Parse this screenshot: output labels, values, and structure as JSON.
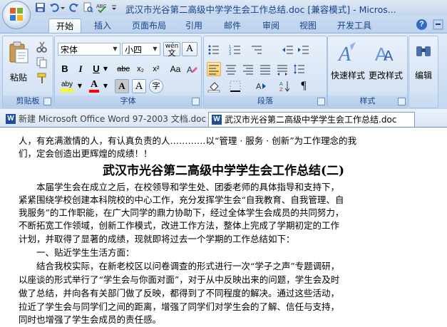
{
  "window": {
    "title": "武汉市光谷第二高级中学学生会工作总结.doc [兼容模式] - Micros..."
  },
  "tabs": [
    {
      "label": "开始"
    },
    {
      "label": "插入"
    },
    {
      "label": "页面布局"
    },
    {
      "label": "引用"
    },
    {
      "label": "邮件"
    },
    {
      "label": "审阅"
    },
    {
      "label": "视图"
    },
    {
      "label": "开发工具"
    }
  ],
  "ribbon": {
    "clipboard": {
      "group_label": "剪贴板",
      "paste_label": "粘贴"
    },
    "font": {
      "group_label": "字体",
      "font_name": "宋体",
      "font_size": "小四",
      "wen_label": "wén",
      "bold": "B",
      "italic": "I",
      "underline": "U",
      "strike": "abc",
      "subscript": "x₂",
      "superscript": "x²",
      "clear": "Aa",
      "highlight": "aby",
      "font_color": "A",
      "shade": "A",
      "border": "A",
      "pinyin": "A",
      "enclose": "字"
    },
    "paragraph": {
      "group_label": "段落"
    },
    "styles": {
      "group_label": "样式",
      "quick_styles": "快速样式",
      "change_styles": "更改样式"
    },
    "editing": {
      "label": "编辑"
    }
  },
  "doc_tabs": [
    {
      "label": "新建 Microsoft Office Word 97-2003 文档.doc"
    },
    {
      "label": "武汉市光谷第二高级中学学生会工作总结.doc"
    }
  ],
  "document": {
    "lines_top": [
      "人，有充满激情的人，有认真负责的人…………以“管理 · 服务 · 创新”为工作理念的我",
      "们，定会创造出更辉煌的成绩！！"
    ],
    "heading": "武汉市光谷第二高级中学学生会工作总结(二)",
    "lines_body": [
      "　　本届学生会在成立之后，在校领导和学生处、团委老师的具体指导和支持下，",
      "紧紧围绕学校创建本科院校的中心工作，充分发挥学生会“自我教育、自我管理、自",
      "我服务”的工作职能，在广大同学的鼎力协助下，经过全体学生会成员的共同努力，",
      "不断拓宽工作领域，创新工作模式，改进工作方法，整体上完成了学期初定的工作",
      "计划，并取得了显著的成绩，现就即将过去一个学期的工作总结如下：",
      "　　一、贴近学生生活方面：",
      "　　结合我校实际，在新老校区以问卷调查的形式进行一次“学子之声”专题调研，",
      "以座谈的形式举行了“学生会与你面对面”，对于从中反映出来的问题，学生会及时",
      "做了总结，并向各有关部门做了反映，都得到了不同程度的解决。通过这些活动，",
      "拉近了学生会与同学们之间的距离，增强了同学们对学生会的了解、信任与支持，",
      "同时也增强了学生会成员的责任感。"
    ]
  }
}
